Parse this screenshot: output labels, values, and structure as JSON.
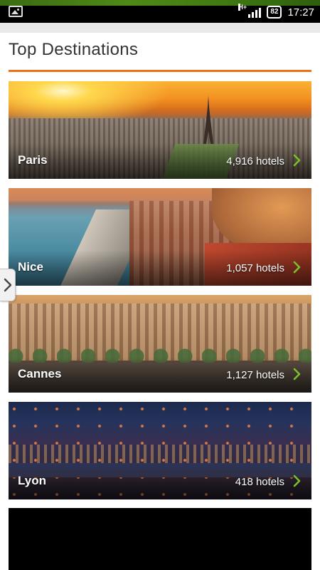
{
  "status_bar": {
    "network": "H+",
    "battery": "82",
    "time": "17:27"
  },
  "header": {
    "title": "Top Destinations",
    "accent_color": "#e8731b"
  },
  "destinations": [
    {
      "city": "Paris",
      "hotels": "4,916 hotels"
    },
    {
      "city": "Nice",
      "hotels": "1,057 hotels"
    },
    {
      "city": "Cannes",
      "hotels": "1,127 hotels"
    },
    {
      "city": "Lyon",
      "hotels": "418 hotels"
    }
  ],
  "icons": {
    "status_left": "image-icon",
    "card_arrow": "chevron-right-icon",
    "drawer": "chevron-right-icon"
  },
  "colors": {
    "chevron": "#7bbf2a"
  }
}
